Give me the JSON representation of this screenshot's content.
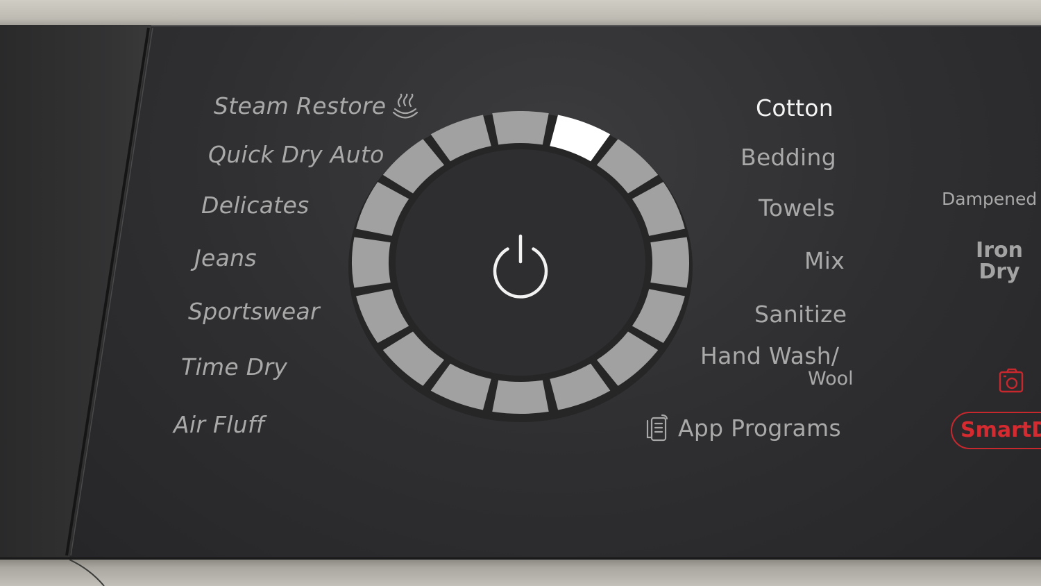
{
  "programs_left": [
    {
      "label": "Steam Restore",
      "icon": "steam-icon"
    },
    {
      "label": "Quick Dry Auto"
    },
    {
      "label": "Delicates"
    },
    {
      "label": "Jeans"
    },
    {
      "label": "Sportswear"
    },
    {
      "label": "Time Dry"
    },
    {
      "label": "Air Fluff"
    }
  ],
  "programs_right": [
    {
      "label": "Cotton",
      "selected": true
    },
    {
      "label": "Bedding"
    },
    {
      "label": "Towels"
    },
    {
      "label": "Mix"
    },
    {
      "label": "Sanitize"
    },
    {
      "label": "Hand Wash/",
      "sublabel": "Wool"
    },
    {
      "label": "App Programs",
      "icon": "app-icon"
    }
  ],
  "dial": {
    "segment_count": 16,
    "selected_segment": "Cotton",
    "power_icon": "power-icon",
    "colors": {
      "segment": "#a1a1a1",
      "selected": "#ffffff",
      "ring": "#1e1e1f"
    }
  },
  "options": {
    "dampened": "Dampened",
    "iron_dry": "Iron Dry",
    "camera_icon": "camera-icon",
    "smart_label": "SmartD",
    "accent": "#d42a30"
  }
}
